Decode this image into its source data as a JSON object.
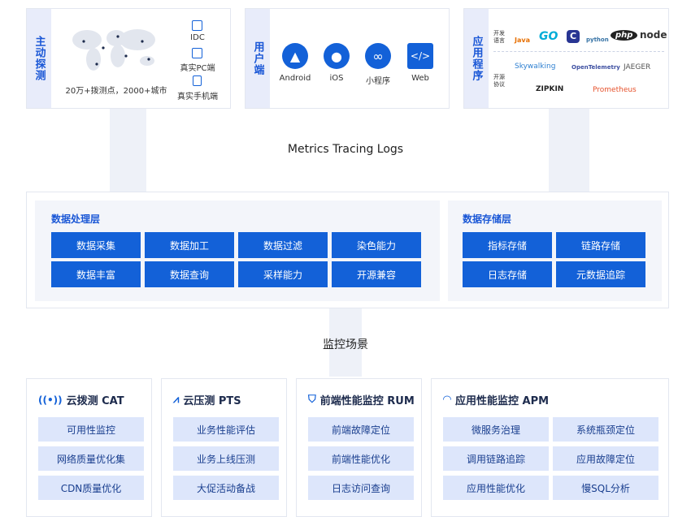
{
  "sources": {
    "active_probe": {
      "label": "主动探测",
      "caption": "20万+拨测点，2000+城市",
      "items": [
        "IDC",
        "真实PC端",
        "真实手机端"
      ]
    },
    "user_side": {
      "label": "用户端",
      "items": [
        "Android",
        "iOS",
        "小程序",
        "Web"
      ]
    },
    "app": {
      "label": "应用程序",
      "lang_label": "开发语言",
      "proto_label": "开源协议",
      "langs": [
        "Java",
        "GO",
        "C",
        "python",
        "php",
        "node"
      ],
      "protocols": [
        "Skywalking",
        "OpenTelemetry",
        "JAEGER",
        "ZIPKIN",
        "Prometheus"
      ]
    }
  },
  "flow": {
    "metrics_label": "Metrics Tracing Logs",
    "scenarios_label": "监控场景"
  },
  "processing": {
    "title": "数据处理层",
    "items": [
      "数据采集",
      "数据加工",
      "数据过滤",
      "染色能力",
      "数据丰富",
      "数据查询",
      "采样能力",
      "开源兼容"
    ]
  },
  "storage": {
    "title": "数据存储层",
    "items": [
      "指标存储",
      "链路存储",
      "日志存储",
      "元数据追踪"
    ]
  },
  "scenes": [
    {
      "title": "云拨测 CAT",
      "icon": "signal-icon",
      "items": [
        "可用性监控",
        "网络质量优化集",
        "CDN质量优化"
      ]
    },
    {
      "title": "云压测 PTS",
      "icon": "pulse-icon",
      "items": [
        "业务性能评估",
        "业务上线压测",
        "大促活动备战"
      ]
    },
    {
      "title": "前端性能监控 RUM",
      "icon": "shield-icon",
      "items": [
        "前端故障定位",
        "前端性能优化",
        "日志访问查询"
      ]
    },
    {
      "title": "应用性能监控 APM",
      "icon": "wave-icon",
      "items": [
        "微服务治理",
        "系统瓶颈定位",
        "调用链路追踪",
        "应用故障定位",
        "应用性能优化",
        "慢SQL分析"
      ]
    }
  ]
}
